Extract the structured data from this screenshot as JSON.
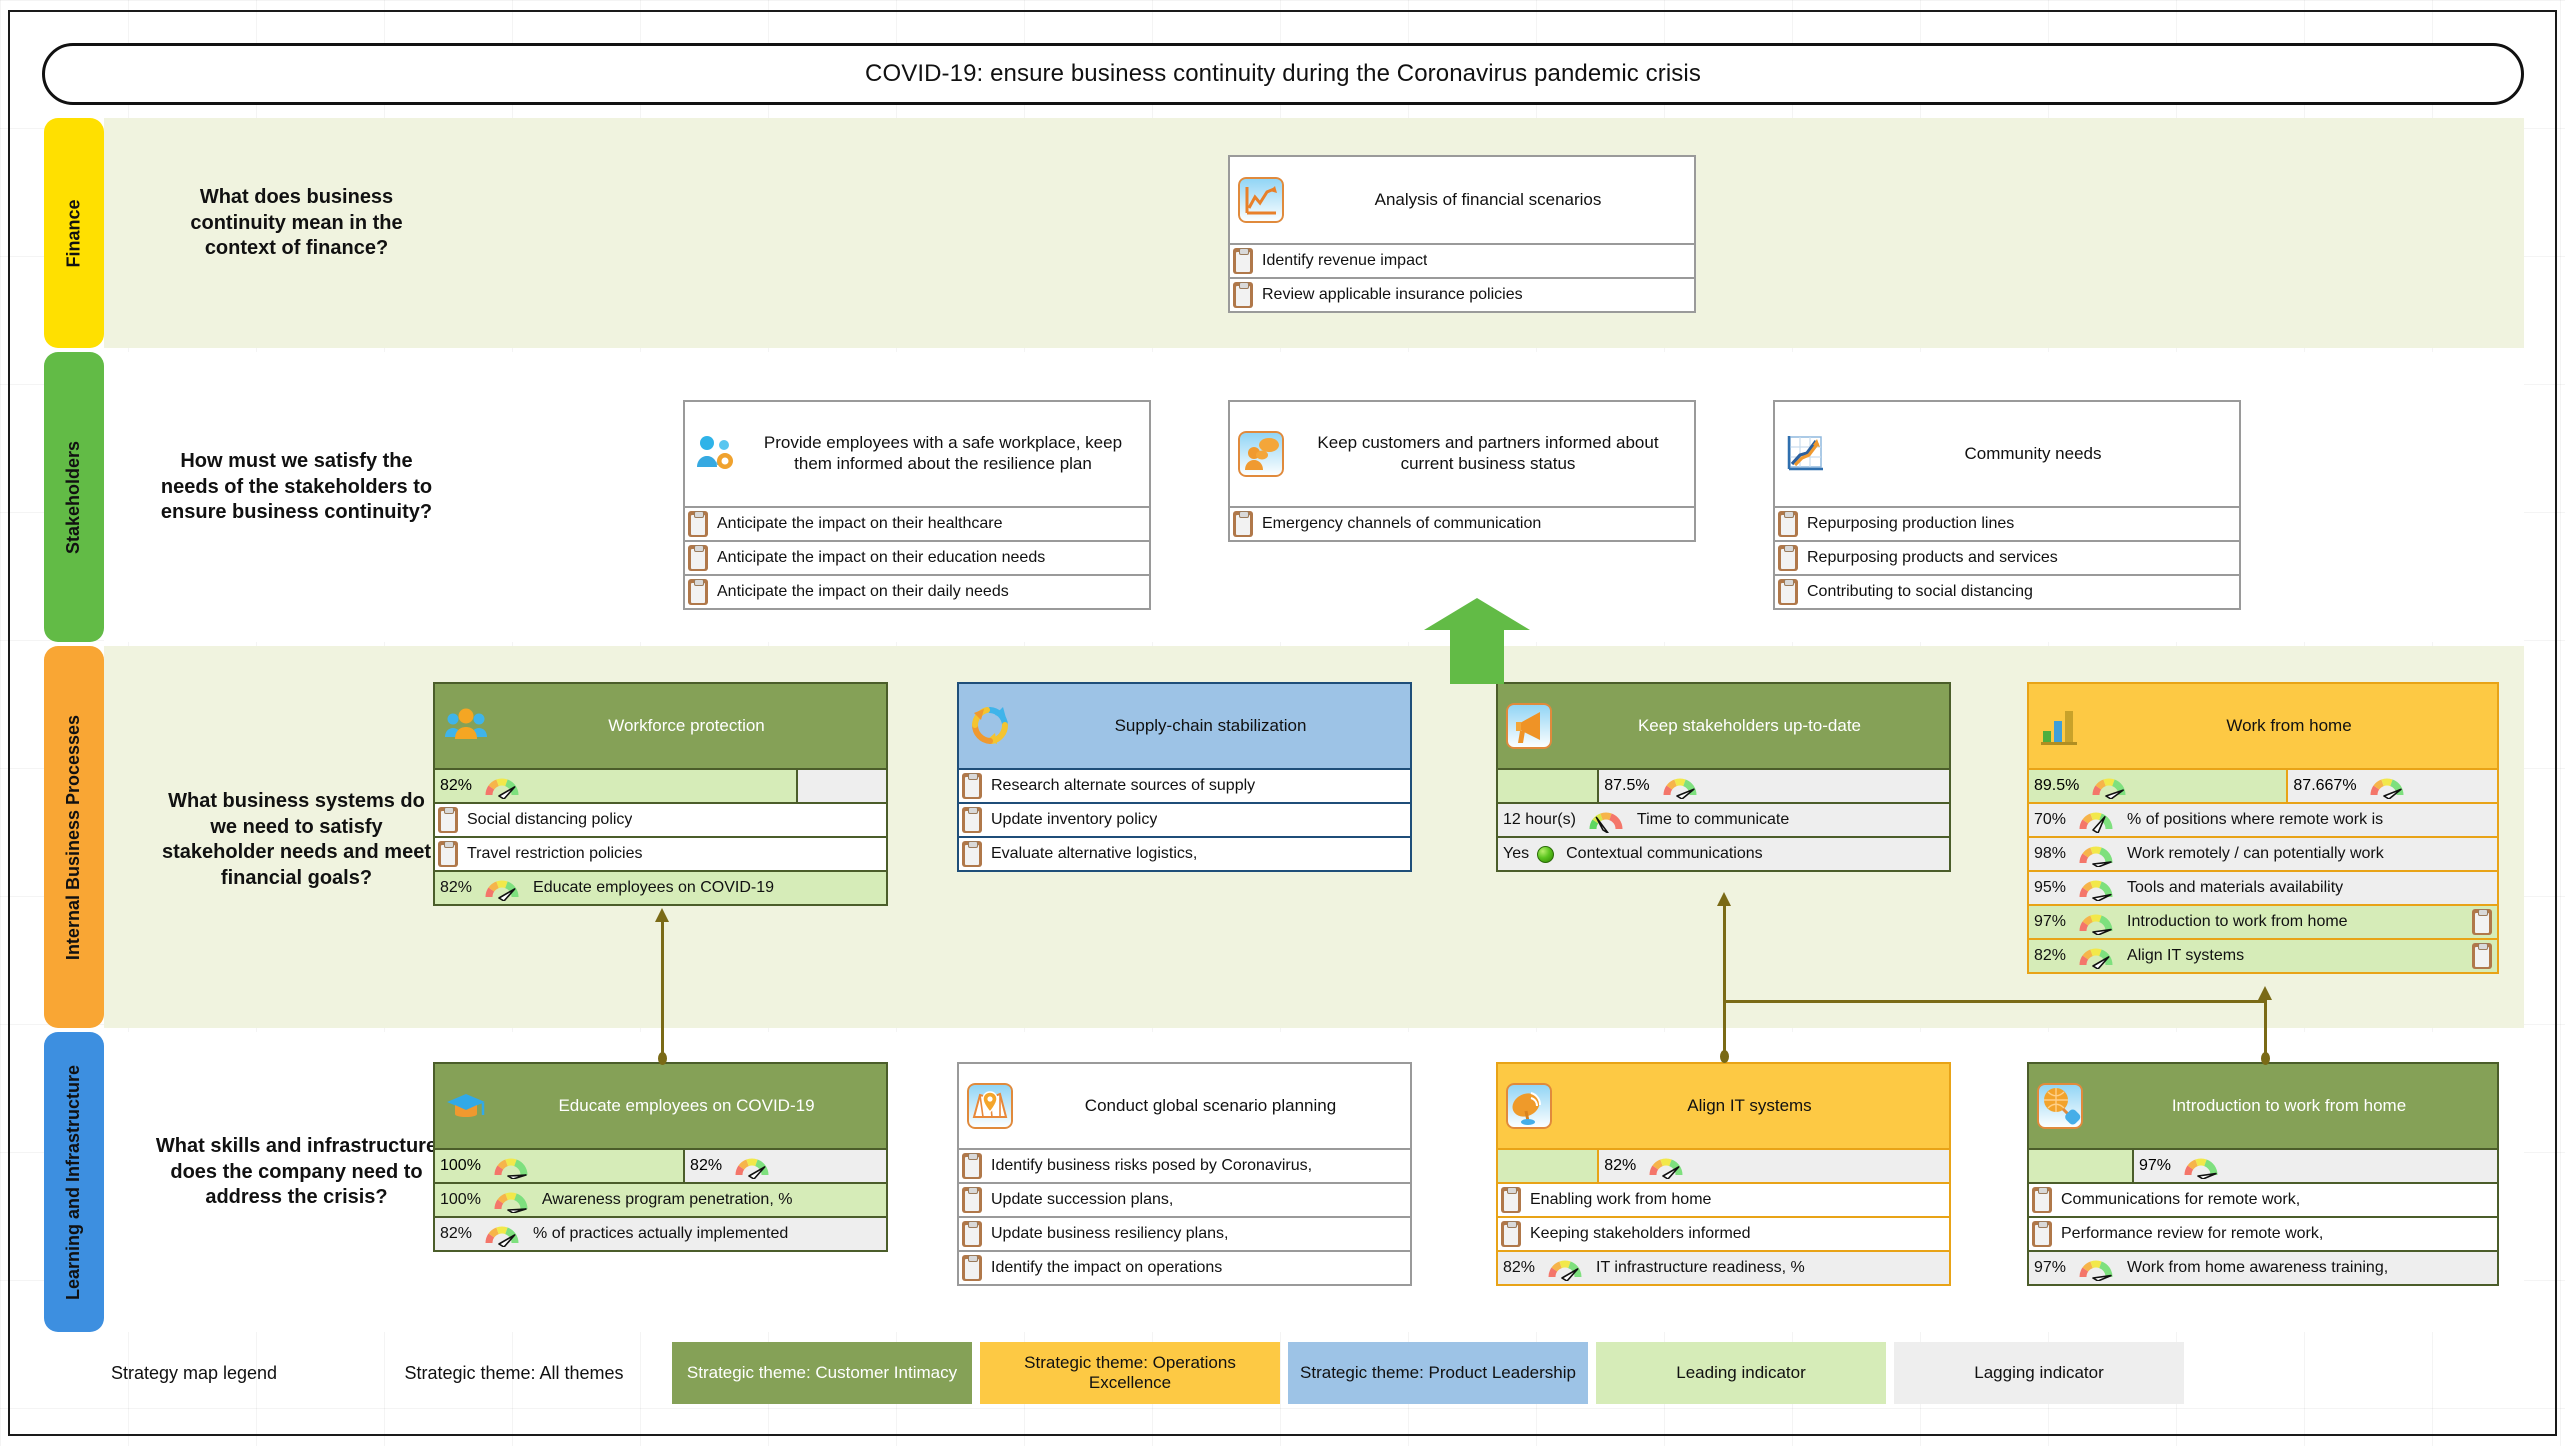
{
  "title": "COVID-19: ensure business continuity during the Coronavirus pandemic crisis",
  "perspectives": [
    {
      "label": "Finance",
      "color": "#ffe000",
      "question": "What does business continuity mean in the context of finance?"
    },
    {
      "label": "Stakeholders",
      "color": "#62bb46",
      "question": "How must we satisfy the needs of the stakeholders to ensure business continuity?"
    },
    {
      "label": "Internal Business Processes",
      "color": "#f9a634",
      "question": "What business systems do we need to satisfy stakeholder needs and meet financial goals?"
    },
    {
      "label": "Learning and Infrastructure",
      "color": "#3d8fe0",
      "question": "What skills and infrastructure does the company need to address the crisis?"
    }
  ],
  "cards": {
    "financial_scenarios": {
      "title": "Analysis of financial scenarios",
      "icon": "line-chart-icon",
      "rows": [
        {
          "kind": "initiative",
          "icon": "clipboard-icon",
          "text": "Identify revenue impact"
        },
        {
          "kind": "initiative",
          "icon": "clipboard-icon",
          "text": "Review applicable insurance policies"
        }
      ]
    },
    "safe_workplace": {
      "title": "Provide employees with a safe workplace, keep them informed about the resilience plan",
      "icon": "people-gear-icon",
      "rows": [
        {
          "kind": "initiative",
          "icon": "clipboard-icon",
          "text": "Anticipate the impact on their healthcare"
        },
        {
          "kind": "initiative",
          "icon": "clipboard-icon",
          "text": "Anticipate the impact on their education needs"
        },
        {
          "kind": "initiative",
          "icon": "clipboard-icon",
          "text": "Anticipate the impact on their daily needs"
        }
      ]
    },
    "keep_customers_informed": {
      "title": "Keep customers and partners informed about current business status",
      "icon": "person-speech-icon",
      "rows": [
        {
          "kind": "initiative",
          "icon": "clipboard-icon",
          "text": "Emergency channels of communication"
        }
      ]
    },
    "community_needs": {
      "title": "Community needs",
      "icon": "trend-graph-icon",
      "rows": [
        {
          "kind": "initiative",
          "icon": "clipboard-icon",
          "text": "Repurposing production lines"
        },
        {
          "kind": "initiative",
          "icon": "clipboard-icon",
          "text": "Repurposing products and services"
        },
        {
          "kind": "initiative",
          "icon": "clipboard-icon",
          "text": "Contributing to social distancing"
        }
      ]
    },
    "workforce_protection": {
      "title": "Workforce protection",
      "icon": "three-people-icon",
      "theme": "Customer Intimacy",
      "score_row": {
        "left_value": "82%",
        "left_indicator": "leading",
        "right_value": "",
        "right_indicator": "lagging"
      },
      "rows": [
        {
          "kind": "initiative",
          "icon": "clipboard-icon",
          "text": "Social distancing policy"
        },
        {
          "kind": "initiative",
          "icon": "clipboard-icon",
          "text": "Travel restriction policies"
        },
        {
          "kind": "kpi",
          "icon": "gauge-icon",
          "value": "82%",
          "text": "Educate employees on COVID-19",
          "indicator": "leading"
        }
      ]
    },
    "supply_chain": {
      "title": "Supply-chain stabilization",
      "icon": "circular-arrows-icon",
      "theme": "Product Leadership",
      "rows": [
        {
          "kind": "initiative",
          "icon": "clipboard-icon",
          "text": "Research alternate sources of supply"
        },
        {
          "kind": "initiative",
          "icon": "clipboard-icon",
          "text": "Update inventory policy"
        },
        {
          "kind": "initiative",
          "icon": "clipboard-icon",
          "text": "Evaluate alternative logistics,"
        }
      ]
    },
    "keep_stakeholders": {
      "title": "Keep stakeholders up-to-date",
      "icon": "megaphone-icon",
      "theme": "Customer Intimacy",
      "score_row": {
        "left_value": "",
        "left_indicator": "leading",
        "right_value": "87.5%",
        "right_indicator": "lagging"
      },
      "rows": [
        {
          "kind": "kpi",
          "icon": "gauge-icon",
          "value": "12 hour(s)",
          "text": "Time to communicate",
          "indicator": "lagging"
        },
        {
          "kind": "kpi",
          "icon": "green-dot-icon",
          "value": "Yes",
          "text": "Contextual communications",
          "indicator": "lagging"
        }
      ]
    },
    "work_from_home": {
      "title": "Work from home",
      "icon": "bar-chart-icon",
      "theme": "Operations Excellence",
      "score_row": {
        "left_value": "89.5%",
        "left_indicator": "leading",
        "right_value": "87.667%",
        "right_indicator": "lagging"
      },
      "rows": [
        {
          "kind": "kpi",
          "icon": "gauge-icon",
          "value": "70%",
          "text": "% of positions where remote work is",
          "indicator": "lagging"
        },
        {
          "kind": "kpi",
          "icon": "gauge-icon",
          "value": "98%",
          "text": "Work remotely / can potentially work",
          "indicator": "lagging"
        },
        {
          "kind": "kpi",
          "icon": "gauge-icon",
          "value": "95%",
          "text": "Tools and materials availability",
          "indicator": "lagging"
        },
        {
          "kind": "kpi",
          "icon": "gauge-icon",
          "value": "97%",
          "text": "Introduction to work from home",
          "indicator": "leading",
          "trailing_icon": "clipboard-icon"
        },
        {
          "kind": "kpi",
          "icon": "gauge-icon",
          "value": "82%",
          "text": "Align IT systems",
          "indicator": "leading",
          "trailing_icon": "clipboard-icon"
        }
      ]
    },
    "educate_employees": {
      "title": "Educate employees on COVID-19",
      "icon": "graduation-cap-icon",
      "theme": "Customer Intimacy",
      "score_row": {
        "left_value": "100%",
        "left_indicator": "leading",
        "right_value": "82%",
        "right_indicator": "lagging"
      },
      "rows": [
        {
          "kind": "kpi",
          "icon": "gauge-icon",
          "value": "100%",
          "text": "Awareness program penetration, %",
          "indicator": "leading"
        },
        {
          "kind": "kpi",
          "icon": "gauge-icon",
          "value": "82%",
          "text": "% of practices actually implemented",
          "indicator": "lagging"
        }
      ]
    },
    "scenario_planning": {
      "title": "Conduct global scenario planning",
      "icon": "map-pin-icon",
      "rows": [
        {
          "kind": "initiative",
          "icon": "clipboard-icon",
          "text": "Identify business risks posed by Coronavirus,"
        },
        {
          "kind": "initiative",
          "icon": "clipboard-icon",
          "text": "Update succession plans,"
        },
        {
          "kind": "initiative",
          "icon": "clipboard-icon",
          "text": "Update business resiliency plans,"
        },
        {
          "kind": "initiative",
          "icon": "clipboard-icon",
          "text": "Identify the impact on operations"
        }
      ]
    },
    "align_it": {
      "title": "Align IT systems",
      "icon": "satellite-dish-icon",
      "theme": "Operations Excellence",
      "score_row": {
        "left_value": "",
        "left_indicator": "leading",
        "right_value": "82%",
        "right_indicator": "lagging"
      },
      "rows": [
        {
          "kind": "initiative",
          "icon": "clipboard-icon",
          "text": "Enabling work from home"
        },
        {
          "kind": "initiative",
          "icon": "clipboard-icon",
          "text": "Keeping stakeholders informed"
        },
        {
          "kind": "kpi",
          "icon": "gauge-icon",
          "value": "82%",
          "text": "IT infrastructure readiness, %",
          "indicator": "lagging"
        }
      ]
    },
    "intro_wfh": {
      "title": "Introduction to work from home",
      "icon": "globe-tag-icon",
      "theme": "Customer Intimacy",
      "score_row": {
        "left_value": "",
        "left_indicator": "leading",
        "right_value": "97%",
        "right_indicator": "lagging"
      },
      "rows": [
        {
          "kind": "initiative",
          "icon": "clipboard-icon",
          "text": "Communications for remote work,"
        },
        {
          "kind": "initiative",
          "icon": "clipboard-icon",
          "text": "Performance review for remote work,"
        },
        {
          "kind": "kpi",
          "icon": "gauge-icon",
          "value": "97%",
          "text": "Work from home awareness training,",
          "indicator": "lagging"
        }
      ]
    }
  },
  "legend": {
    "caption": "Strategy map legend",
    "all_themes": "Strategic theme: All themes",
    "chips": [
      {
        "label": "Strategic theme: Customer Intimacy",
        "color": "#85a157",
        "text_color": "#ffffff"
      },
      {
        "label": "Strategic theme: Operations Excellence",
        "color": "#fdc944",
        "text_color": "#111111"
      },
      {
        "label": "Strategic theme: Product Leadership",
        "color": "#9dc3e6",
        "text_color": "#111111"
      },
      {
        "label": "Leading indicator",
        "color": "#d6ecb8",
        "text_color": "#111111"
      },
      {
        "label": "Lagging indicator",
        "color": "#eeeeee",
        "text_color": "#111111"
      }
    ]
  },
  "colors": {
    "band_tint": "#f0f3df",
    "theme_green": "#85a157",
    "theme_blue": "#9dc3e6",
    "theme_orange": "#fdc944",
    "leading": "#d6ecb8",
    "lagging": "#eeeeee",
    "connector": "#7a6a16",
    "big_arrow": "#62bb46"
  }
}
